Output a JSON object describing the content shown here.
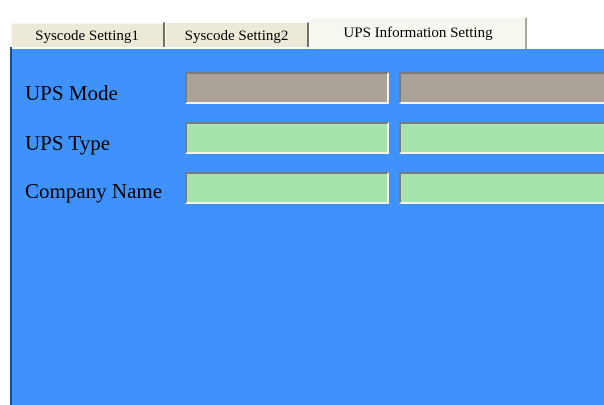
{
  "tabs": [
    {
      "label": "Syscode Setting1",
      "active": false
    },
    {
      "label": "Syscode Setting2",
      "active": false
    },
    {
      "label": "UPS Information Setting",
      "active": true
    }
  ],
  "form": {
    "rows": [
      {
        "label": "UPS Mode",
        "field1_value": "",
        "field2_value": "",
        "field_color": "#aba398",
        "editable": false
      },
      {
        "label": "UPS Type",
        "field1_value": "",
        "field2_value": "",
        "field_color": "#a6e3ad",
        "editable": true
      },
      {
        "label": "Company Name",
        "field1_value": "",
        "field2_value": "",
        "field_color": "#a6e3ad",
        "editable": true
      }
    ]
  },
  "colors": {
    "panel_background": "#3f92fc",
    "tab_background": "#ece9d8",
    "active_tab_background": "#f7f6ef",
    "readonly_field": "#aba398",
    "editable_field": "#a6e3ad"
  }
}
